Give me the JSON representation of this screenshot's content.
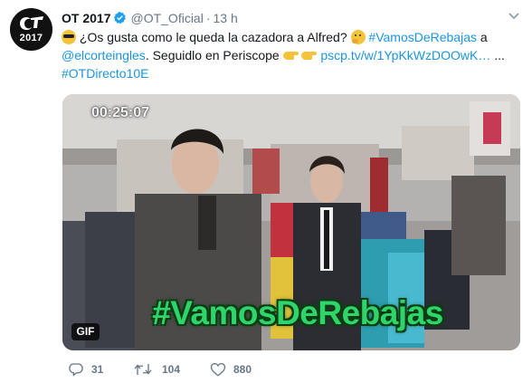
{
  "account": {
    "display_name": "OT 2017",
    "handle": "@OT_Oficial",
    "separator": "·",
    "time": "13 h",
    "avatar_year": "2017",
    "verified": true
  },
  "tweet": {
    "text_part1": "¿Os gusta como le queda la cazadora a Alfred?",
    "hashtag1": "#VamosDeRebajas",
    "text_part2": "a",
    "mention": "@elcorteingles",
    "text_part3": ". Seguidlo en Periscope",
    "link": "pscp.tv/w/1YpKkWzDOOwK…",
    "text_part4": "...",
    "hashtag2": "#OTDirecto10E",
    "emojis": [
      "sunglasses",
      "thinking-face",
      "point-right",
      "point-right"
    ]
  },
  "media": {
    "timestamp": "00:25:07",
    "overlay_hashtag": "#VamosDeRebajas",
    "badge": "GIF"
  },
  "actions": {
    "replies": "31",
    "retweets": "104",
    "likes": "880"
  },
  "colors": {
    "link": "#1b95e0",
    "verified": "#1da1f2",
    "overlay_text": "#2fd46a",
    "muted": "#657786"
  }
}
